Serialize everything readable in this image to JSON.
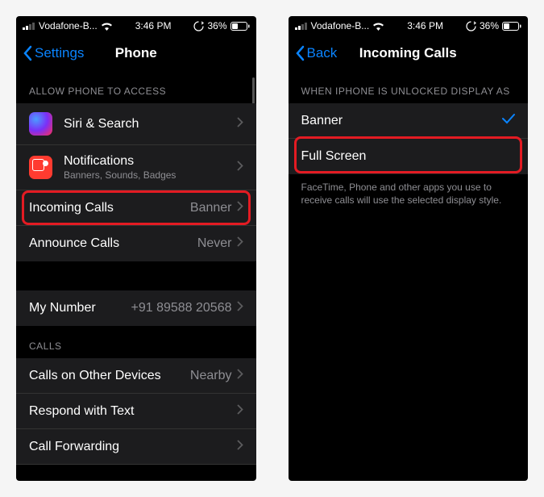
{
  "left": {
    "status": {
      "carrier": "Vodafone-B...",
      "time": "3:46 PM",
      "battery": "36%"
    },
    "nav": {
      "back": "Settings",
      "title": "Phone"
    },
    "sections": {
      "allow_header": "ALLOW PHONE TO ACCESS",
      "siri": "Siri & Search",
      "notifications": {
        "title": "Notifications",
        "subtitle": "Banners, Sounds, Badges"
      },
      "incoming": {
        "title": "Incoming Calls",
        "value": "Banner"
      },
      "announce": {
        "title": "Announce Calls",
        "value": "Never"
      },
      "mynumber": {
        "title": "My Number",
        "value": "+91 89588 20568"
      },
      "calls_header": "CALLS",
      "other_devices": {
        "title": "Calls on Other Devices",
        "value": "Nearby"
      },
      "respond": "Respond with Text",
      "forwarding": "Call Forwarding"
    }
  },
  "right": {
    "status": {
      "carrier": "Vodafone-B...",
      "time": "3:46 PM",
      "battery": "36%"
    },
    "nav": {
      "back": "Back",
      "title": "Incoming Calls"
    },
    "header": "WHEN IPHONE IS UNLOCKED DISPLAY AS",
    "options": {
      "banner": "Banner",
      "fullscreen": "Full Screen"
    },
    "footer": "FaceTime, Phone and other apps you use to receive calls will use the selected display style."
  }
}
